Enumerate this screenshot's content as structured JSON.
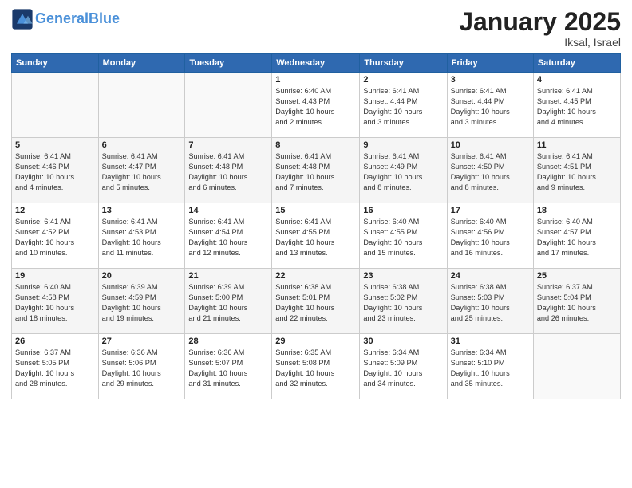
{
  "header": {
    "logo_line1": "General",
    "logo_line2": "Blue",
    "month_title": "January 2025",
    "location": "Iksal, Israel"
  },
  "days_of_week": [
    "Sunday",
    "Monday",
    "Tuesday",
    "Wednesday",
    "Thursday",
    "Friday",
    "Saturday"
  ],
  "weeks": [
    [
      {
        "day": "",
        "info": ""
      },
      {
        "day": "",
        "info": ""
      },
      {
        "day": "",
        "info": ""
      },
      {
        "day": "1",
        "info": "Sunrise: 6:40 AM\nSunset: 4:43 PM\nDaylight: 10 hours\nand 2 minutes."
      },
      {
        "day": "2",
        "info": "Sunrise: 6:41 AM\nSunset: 4:44 PM\nDaylight: 10 hours\nand 3 minutes."
      },
      {
        "day": "3",
        "info": "Sunrise: 6:41 AM\nSunset: 4:44 PM\nDaylight: 10 hours\nand 3 minutes."
      },
      {
        "day": "4",
        "info": "Sunrise: 6:41 AM\nSunset: 4:45 PM\nDaylight: 10 hours\nand 4 minutes."
      }
    ],
    [
      {
        "day": "5",
        "info": "Sunrise: 6:41 AM\nSunset: 4:46 PM\nDaylight: 10 hours\nand 4 minutes."
      },
      {
        "day": "6",
        "info": "Sunrise: 6:41 AM\nSunset: 4:47 PM\nDaylight: 10 hours\nand 5 minutes."
      },
      {
        "day": "7",
        "info": "Sunrise: 6:41 AM\nSunset: 4:48 PM\nDaylight: 10 hours\nand 6 minutes."
      },
      {
        "day": "8",
        "info": "Sunrise: 6:41 AM\nSunset: 4:48 PM\nDaylight: 10 hours\nand 7 minutes."
      },
      {
        "day": "9",
        "info": "Sunrise: 6:41 AM\nSunset: 4:49 PM\nDaylight: 10 hours\nand 8 minutes."
      },
      {
        "day": "10",
        "info": "Sunrise: 6:41 AM\nSunset: 4:50 PM\nDaylight: 10 hours\nand 8 minutes."
      },
      {
        "day": "11",
        "info": "Sunrise: 6:41 AM\nSunset: 4:51 PM\nDaylight: 10 hours\nand 9 minutes."
      }
    ],
    [
      {
        "day": "12",
        "info": "Sunrise: 6:41 AM\nSunset: 4:52 PM\nDaylight: 10 hours\nand 10 minutes."
      },
      {
        "day": "13",
        "info": "Sunrise: 6:41 AM\nSunset: 4:53 PM\nDaylight: 10 hours\nand 11 minutes."
      },
      {
        "day": "14",
        "info": "Sunrise: 6:41 AM\nSunset: 4:54 PM\nDaylight: 10 hours\nand 12 minutes."
      },
      {
        "day": "15",
        "info": "Sunrise: 6:41 AM\nSunset: 4:55 PM\nDaylight: 10 hours\nand 13 minutes."
      },
      {
        "day": "16",
        "info": "Sunrise: 6:40 AM\nSunset: 4:55 PM\nDaylight: 10 hours\nand 15 minutes."
      },
      {
        "day": "17",
        "info": "Sunrise: 6:40 AM\nSunset: 4:56 PM\nDaylight: 10 hours\nand 16 minutes."
      },
      {
        "day": "18",
        "info": "Sunrise: 6:40 AM\nSunset: 4:57 PM\nDaylight: 10 hours\nand 17 minutes."
      }
    ],
    [
      {
        "day": "19",
        "info": "Sunrise: 6:40 AM\nSunset: 4:58 PM\nDaylight: 10 hours\nand 18 minutes."
      },
      {
        "day": "20",
        "info": "Sunrise: 6:39 AM\nSunset: 4:59 PM\nDaylight: 10 hours\nand 19 minutes."
      },
      {
        "day": "21",
        "info": "Sunrise: 6:39 AM\nSunset: 5:00 PM\nDaylight: 10 hours\nand 21 minutes."
      },
      {
        "day": "22",
        "info": "Sunrise: 6:38 AM\nSunset: 5:01 PM\nDaylight: 10 hours\nand 22 minutes."
      },
      {
        "day": "23",
        "info": "Sunrise: 6:38 AM\nSunset: 5:02 PM\nDaylight: 10 hours\nand 23 minutes."
      },
      {
        "day": "24",
        "info": "Sunrise: 6:38 AM\nSunset: 5:03 PM\nDaylight: 10 hours\nand 25 minutes."
      },
      {
        "day": "25",
        "info": "Sunrise: 6:37 AM\nSunset: 5:04 PM\nDaylight: 10 hours\nand 26 minutes."
      }
    ],
    [
      {
        "day": "26",
        "info": "Sunrise: 6:37 AM\nSunset: 5:05 PM\nDaylight: 10 hours\nand 28 minutes."
      },
      {
        "day": "27",
        "info": "Sunrise: 6:36 AM\nSunset: 5:06 PM\nDaylight: 10 hours\nand 29 minutes."
      },
      {
        "day": "28",
        "info": "Sunrise: 6:36 AM\nSunset: 5:07 PM\nDaylight: 10 hours\nand 31 minutes."
      },
      {
        "day": "29",
        "info": "Sunrise: 6:35 AM\nSunset: 5:08 PM\nDaylight: 10 hours\nand 32 minutes."
      },
      {
        "day": "30",
        "info": "Sunrise: 6:34 AM\nSunset: 5:09 PM\nDaylight: 10 hours\nand 34 minutes."
      },
      {
        "day": "31",
        "info": "Sunrise: 6:34 AM\nSunset: 5:10 PM\nDaylight: 10 hours\nand 35 minutes."
      },
      {
        "day": "",
        "info": ""
      }
    ]
  ]
}
